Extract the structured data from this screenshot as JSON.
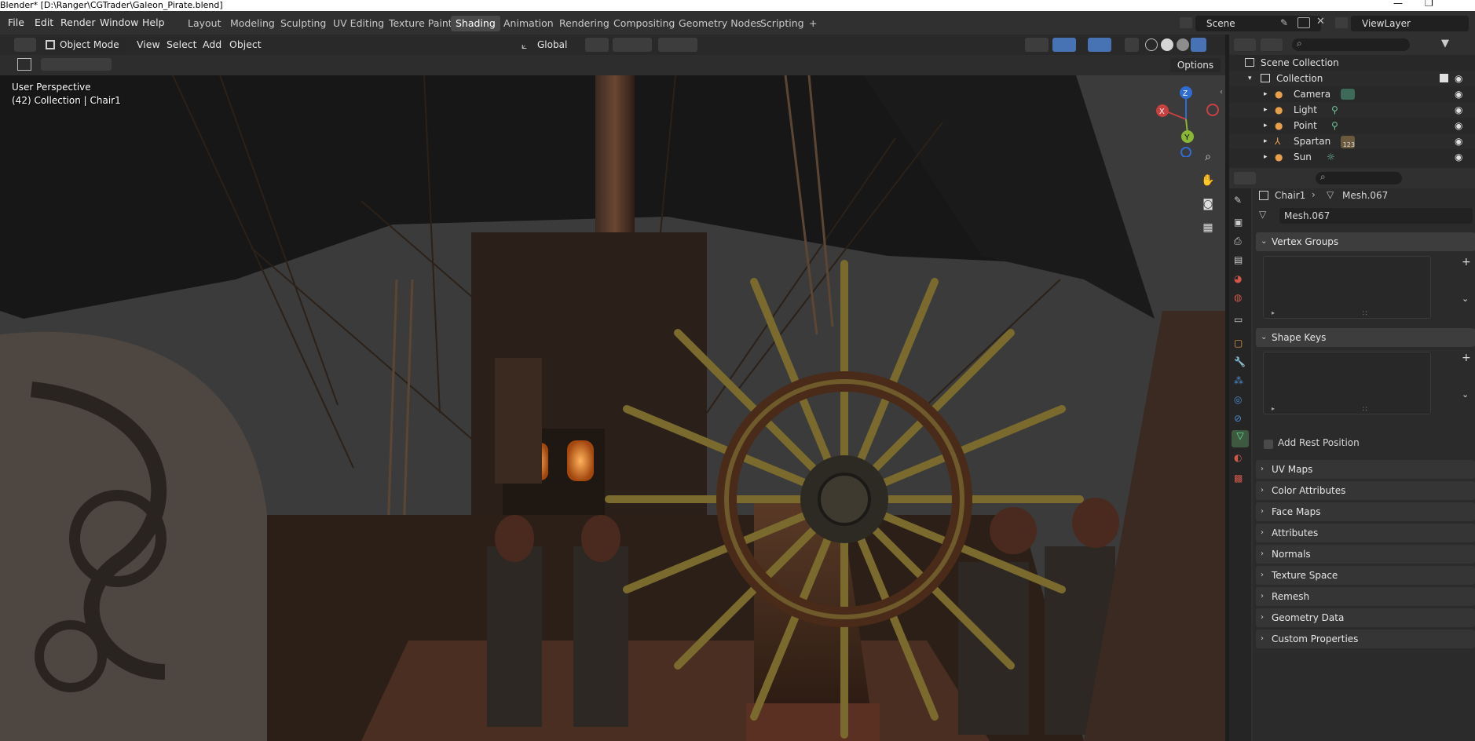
{
  "window": {
    "title": "Blender* [D:\\Ranger\\CGTrader\\Galeon_Pirate.blend]",
    "minimize": "—",
    "restore": "❐"
  },
  "menus": [
    "File",
    "Edit",
    "Render",
    "Window",
    "Help"
  ],
  "workspaces": [
    "Layout",
    "Modeling",
    "Sculpting",
    "UV Editing",
    "Texture Paint",
    "Shading",
    "Animation",
    "Rendering",
    "Compositing",
    "Geometry Nodes",
    "Scripting"
  ],
  "active_workspace": "Shading",
  "add_workspace": "+",
  "scene": {
    "name": "Scene",
    "view_layer": "ViewLayer"
  },
  "viewport": {
    "mode": "Object Mode",
    "menus": [
      "View",
      "Select",
      "Add",
      "Object"
    ],
    "transform_orientation": "Global",
    "options_label": "Options",
    "perspective_label": "User Perspective",
    "collection_label": "(42) Collection | Chair1",
    "gizmo": {
      "z": "Z",
      "y": "Y",
      "x": "X"
    }
  },
  "outliner": {
    "root": "Scene Collection",
    "collection": "Collection",
    "items": [
      {
        "name": "Camera",
        "icon": "camera-icon"
      },
      {
        "name": "Light",
        "icon": "light-icon"
      },
      {
        "name": "Point",
        "icon": "light-icon"
      },
      {
        "name": "Spartan",
        "icon": "armature-icon",
        "badge": "123"
      },
      {
        "name": "Sun",
        "icon": "sun-icon"
      }
    ]
  },
  "properties": {
    "breadcrumb_object": "Chair1",
    "breadcrumb_data": "Mesh.067",
    "data_name": "Mesh.067",
    "vertex_groups": "Vertex Groups",
    "shape_keys": "Shape Keys",
    "add_rest_position": "Add Rest Position",
    "collapsed_panels": [
      "UV Maps",
      "Color Attributes",
      "Face Maps",
      "Attributes",
      "Normals",
      "Texture Space",
      "Remesh",
      "Geometry Data",
      "Custom Properties"
    ]
  },
  "colors": {
    "accent_blue": "#4772b3",
    "gizmo_x": "#c94040",
    "gizmo_y": "#8ab833",
    "gizmo_z": "#2f6dd2"
  }
}
